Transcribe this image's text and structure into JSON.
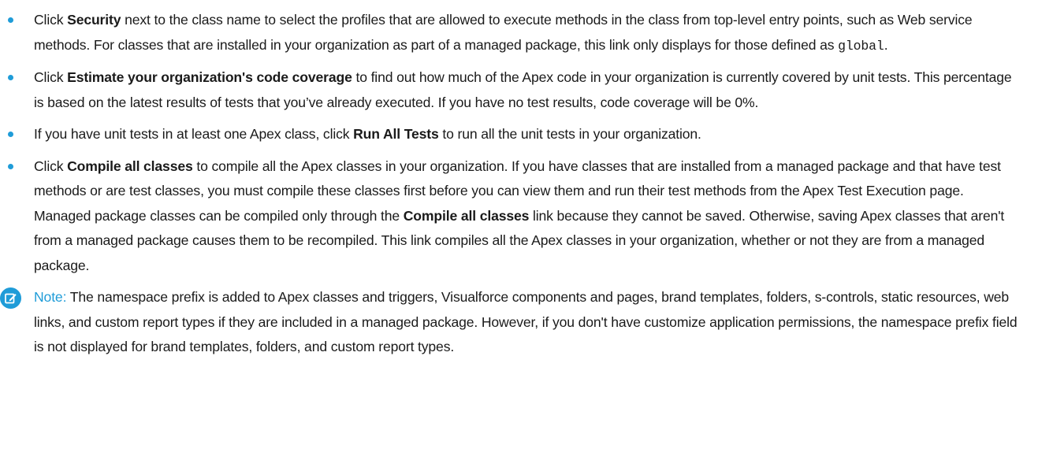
{
  "bullets": [
    {
      "pre": "Click ",
      "bold": "Security",
      "mid": " next to the class name to select the profiles that are allowed to execute methods in the class from top-level entry points, such as Web service methods. For classes that are installed in your organization as part of a managed package, this link only displays for those defined as ",
      "code": "global",
      "post": "."
    },
    {
      "pre": "Click ",
      "bold": "Estimate your organization's code coverage",
      "mid": " to find out how much of the Apex code in your organization is currently covered by unit tests. This percentage is based on the latest results of tests that you’ve already executed. If you have no test results, code coverage will be 0%."
    },
    {
      "pre": "If you have unit tests in at least one Apex class, click ",
      "bold": "Run All Tests",
      "mid": " to run all the unit tests in your organization."
    },
    {
      "pre": "Click ",
      "bold": "Compile all classes",
      "mid": " to compile all the Apex classes in your organization. If you have classes that are installed from a managed package and that have test methods or are test classes, you must compile these classes first before you can view them and run their test methods from the Apex Test Execution page. Managed package classes can be compiled only through the ",
      "bold2": "Compile all classes",
      "post": " link because they cannot be saved. Otherwise, saving Apex classes that aren't from a managed package causes them to be recompiled. This link compiles all the Apex classes in your organization, whether or not they are from a managed package."
    }
  ],
  "note": {
    "label": "Note:",
    "text": " The namespace prefix is added to Apex classes and triggers, Visualforce components and pages, brand templates, folders, s-controls, static resources, web links, and custom report types if they are included in a managed package. However, if you don't have customize application permissions, the namespace prefix field is not displayed for brand templates, folders, and custom report types.",
    "icon": "edit-note-icon"
  },
  "colors": {
    "accent": "#1f9cd8",
    "text": "#1a1a1a"
  }
}
